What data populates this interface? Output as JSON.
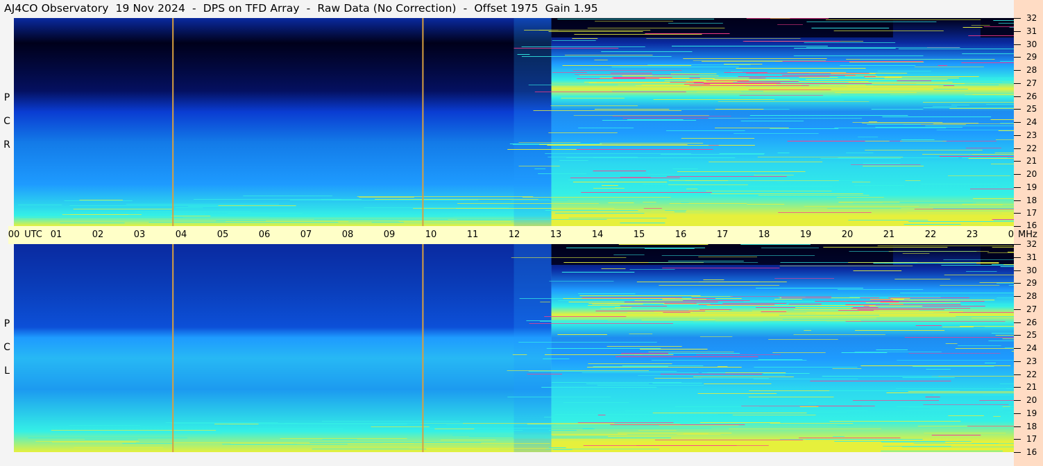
{
  "title": "AJ4CO Observatory  19 Nov 2024  -  DPS on TFD Array  -  Raw Data (No Correction)  -  Offset 1975  Gain 1.95",
  "panels": [
    {
      "id": "rcp",
      "label": [
        "R",
        "C",
        "P"
      ]
    },
    {
      "id": "lcp",
      "label": [
        "L",
        "C",
        "P"
      ]
    }
  ],
  "time_axis": {
    "utc_label": "UTC",
    "ticks": [
      "00",
      "01",
      "02",
      "03",
      "04",
      "05",
      "06",
      "07",
      "08",
      "09",
      "10",
      "11",
      "12",
      "13",
      "14",
      "15",
      "16",
      "17",
      "18",
      "19",
      "20",
      "21",
      "22",
      "23",
      "00"
    ]
  },
  "freq_axis": {
    "unit": "MHz",
    "ticks": [
      "32",
      "31",
      "30",
      "29",
      "28",
      "27",
      "26",
      "25",
      "24",
      "23",
      "22",
      "21",
      "20",
      "19",
      "18",
      "17",
      "16"
    ]
  },
  "colors": {
    "background_dark": "#00001a",
    "low": "#0a3cd2",
    "mid": "#1e9bff",
    "high": "#34f0e6",
    "hot": "#e6f03c",
    "peak": "#ff3c8c",
    "marker_line": "#d8a040",
    "axis_band": "#ffffc8",
    "freq_band": "#ffdcc4"
  },
  "chart_data": {
    "type": "heatmap",
    "title": "AJ4CO Observatory  19 Nov 2024  -  DPS on TFD Array  -  Raw Data (No Correction)  -  Offset 1975  Gain 1.95",
    "xlabel": "UTC",
    "ylabel": "MHz",
    "xlim": [
      0,
      24
    ],
    "ylim": [
      16,
      32
    ],
    "grid": false,
    "marker_times_utc": [
      3.8,
      9.8
    ],
    "panels": [
      "RCP",
      "LCP"
    ]
  }
}
